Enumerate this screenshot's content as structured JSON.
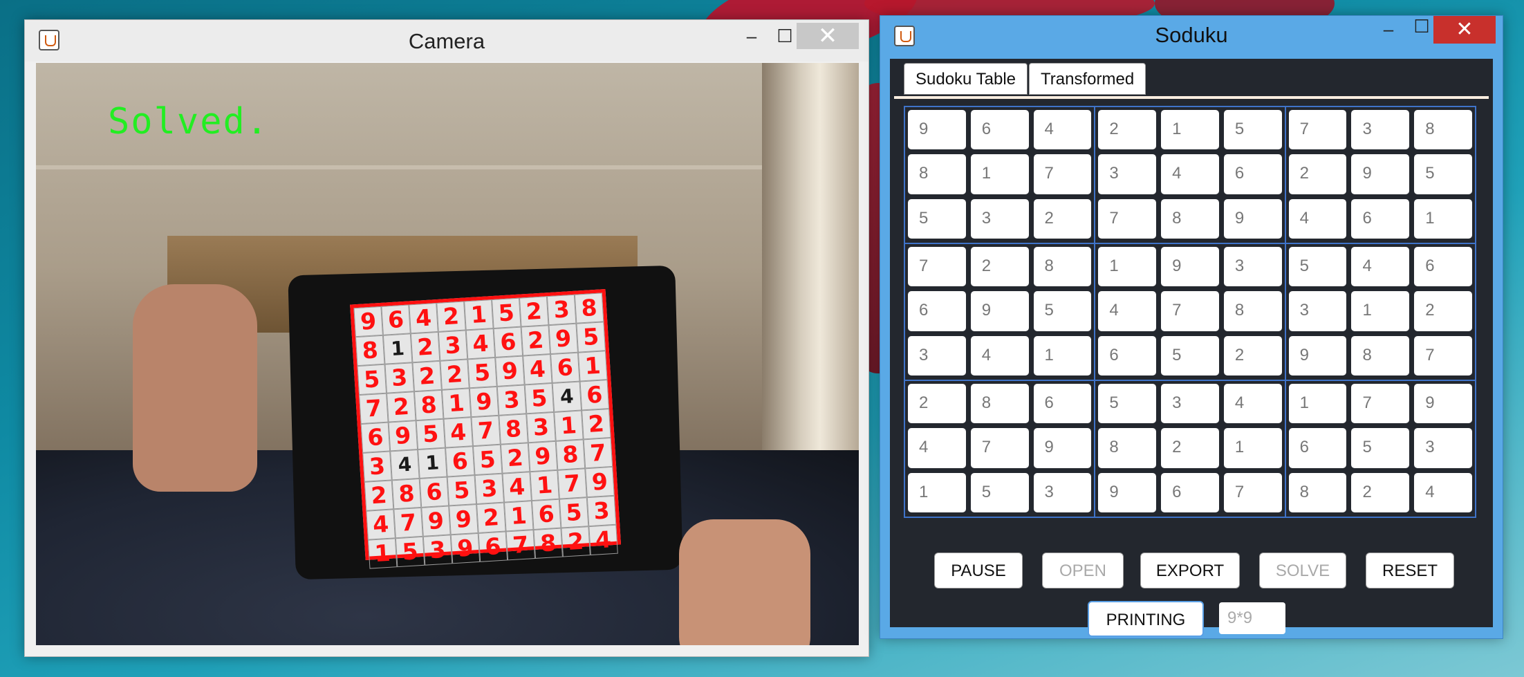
{
  "camera_window": {
    "title": "Camera",
    "status_overlay": "Solved.",
    "minimize": "‒",
    "maximize": "☐",
    "close": "✕",
    "photo_grid": [
      [
        9,
        6,
        4,
        2,
        1,
        5,
        2,
        3,
        8
      ],
      [
        8,
        1,
        2,
        3,
        4,
        6,
        2,
        9,
        5
      ],
      [
        5,
        3,
        2,
        2,
        5,
        9,
        4,
        6,
        1
      ],
      [
        7,
        2,
        8,
        1,
        9,
        3,
        5,
        4,
        6
      ],
      [
        6,
        9,
        5,
        4,
        7,
        8,
        3,
        1,
        2
      ],
      [
        3,
        4,
        1,
        6,
        5,
        2,
        9,
        8,
        7
      ],
      [
        2,
        8,
        6,
        5,
        3,
        4,
        1,
        7,
        9
      ],
      [
        4,
        7,
        9,
        9,
        2,
        1,
        6,
        5,
        3
      ],
      [
        1,
        5,
        3,
        9,
        6,
        7,
        8,
        2,
        4
      ]
    ]
  },
  "sudoku_window": {
    "title": "Soduku",
    "minimize": "‒",
    "maximize": "☐",
    "close": "✕",
    "tabs": [
      "Sudoku Table",
      "Transformed"
    ],
    "grid": [
      [
        9,
        6,
        4,
        2,
        1,
        5,
        7,
        3,
        8
      ],
      [
        8,
        1,
        7,
        3,
        4,
        6,
        2,
        9,
        5
      ],
      [
        5,
        3,
        2,
        7,
        8,
        9,
        4,
        6,
        1
      ],
      [
        7,
        2,
        8,
        1,
        9,
        3,
        5,
        4,
        6
      ],
      [
        6,
        9,
        5,
        4,
        7,
        8,
        3,
        1,
        2
      ],
      [
        3,
        4,
        1,
        6,
        5,
        2,
        9,
        8,
        7
      ],
      [
        2,
        8,
        6,
        5,
        3,
        4,
        1,
        7,
        9
      ],
      [
        4,
        7,
        9,
        8,
        2,
        1,
        6,
        5,
        3
      ],
      [
        1,
        5,
        3,
        9,
        6,
        7,
        8,
        2,
        4
      ]
    ],
    "buttons": {
      "pause": "PAUSE",
      "open": "OPEN",
      "export": "EXPORT",
      "solve": "SOLVE",
      "reset": "RESET",
      "printing": "PRINTING"
    },
    "size_field": "9*9"
  }
}
